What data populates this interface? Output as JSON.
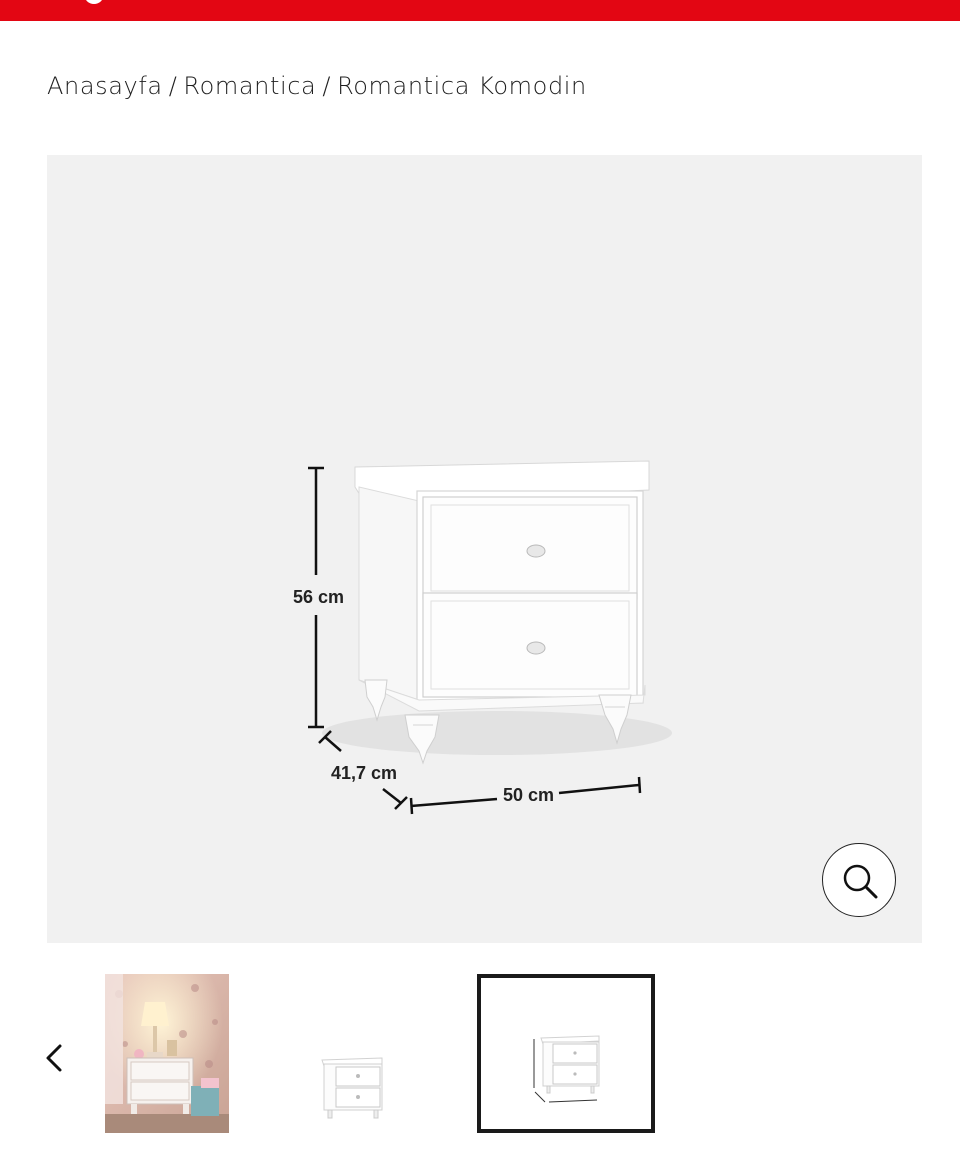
{
  "header": {
    "brand_color": "#e30613"
  },
  "breadcrumb": {
    "items": [
      {
        "label": "Anasayfa"
      },
      {
        "label": "Romantica"
      },
      {
        "label": "Romantica Komodin"
      }
    ],
    "separator": "/"
  },
  "product_image": {
    "background": "#f1f1f1",
    "dimensions": {
      "height": "56 cm",
      "depth": "41,7 cm",
      "width": "50 cm"
    }
  },
  "zoom": {
    "icon": "magnifier-icon"
  },
  "thumbnails": {
    "prev_icon": "chevron-left-icon",
    "items": [
      {
        "name": "room-photo",
        "selected": false
      },
      {
        "name": "nightstand-photo",
        "selected": false
      },
      {
        "name": "dimensions-photo",
        "selected": true
      }
    ]
  }
}
